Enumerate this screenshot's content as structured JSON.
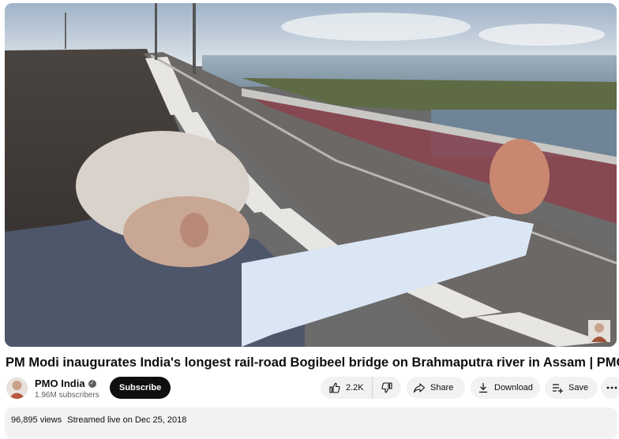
{
  "video": {
    "title": "PM Modi inaugurates India's longest rail-road Bogibeel bridge on Brahmaputra river in Assam | PMO"
  },
  "channel": {
    "name": "PMO India",
    "subscribers": "1.96M subscribers",
    "verified_icon": "check-circle-icon"
  },
  "actions": {
    "subscribe": "Subscribe",
    "like_count": "2.2K",
    "share": "Share",
    "download": "Download",
    "save": "Save",
    "more_icon": "more-horizontal-icon"
  },
  "description": {
    "views": "96,895 views",
    "streamed": "Streamed live on Dec 25, 2018"
  },
  "colors": {
    "subscribe_bg": "#0f0f0f",
    "pill_bg": "#f2f2f2",
    "meta_text": "#606060"
  }
}
